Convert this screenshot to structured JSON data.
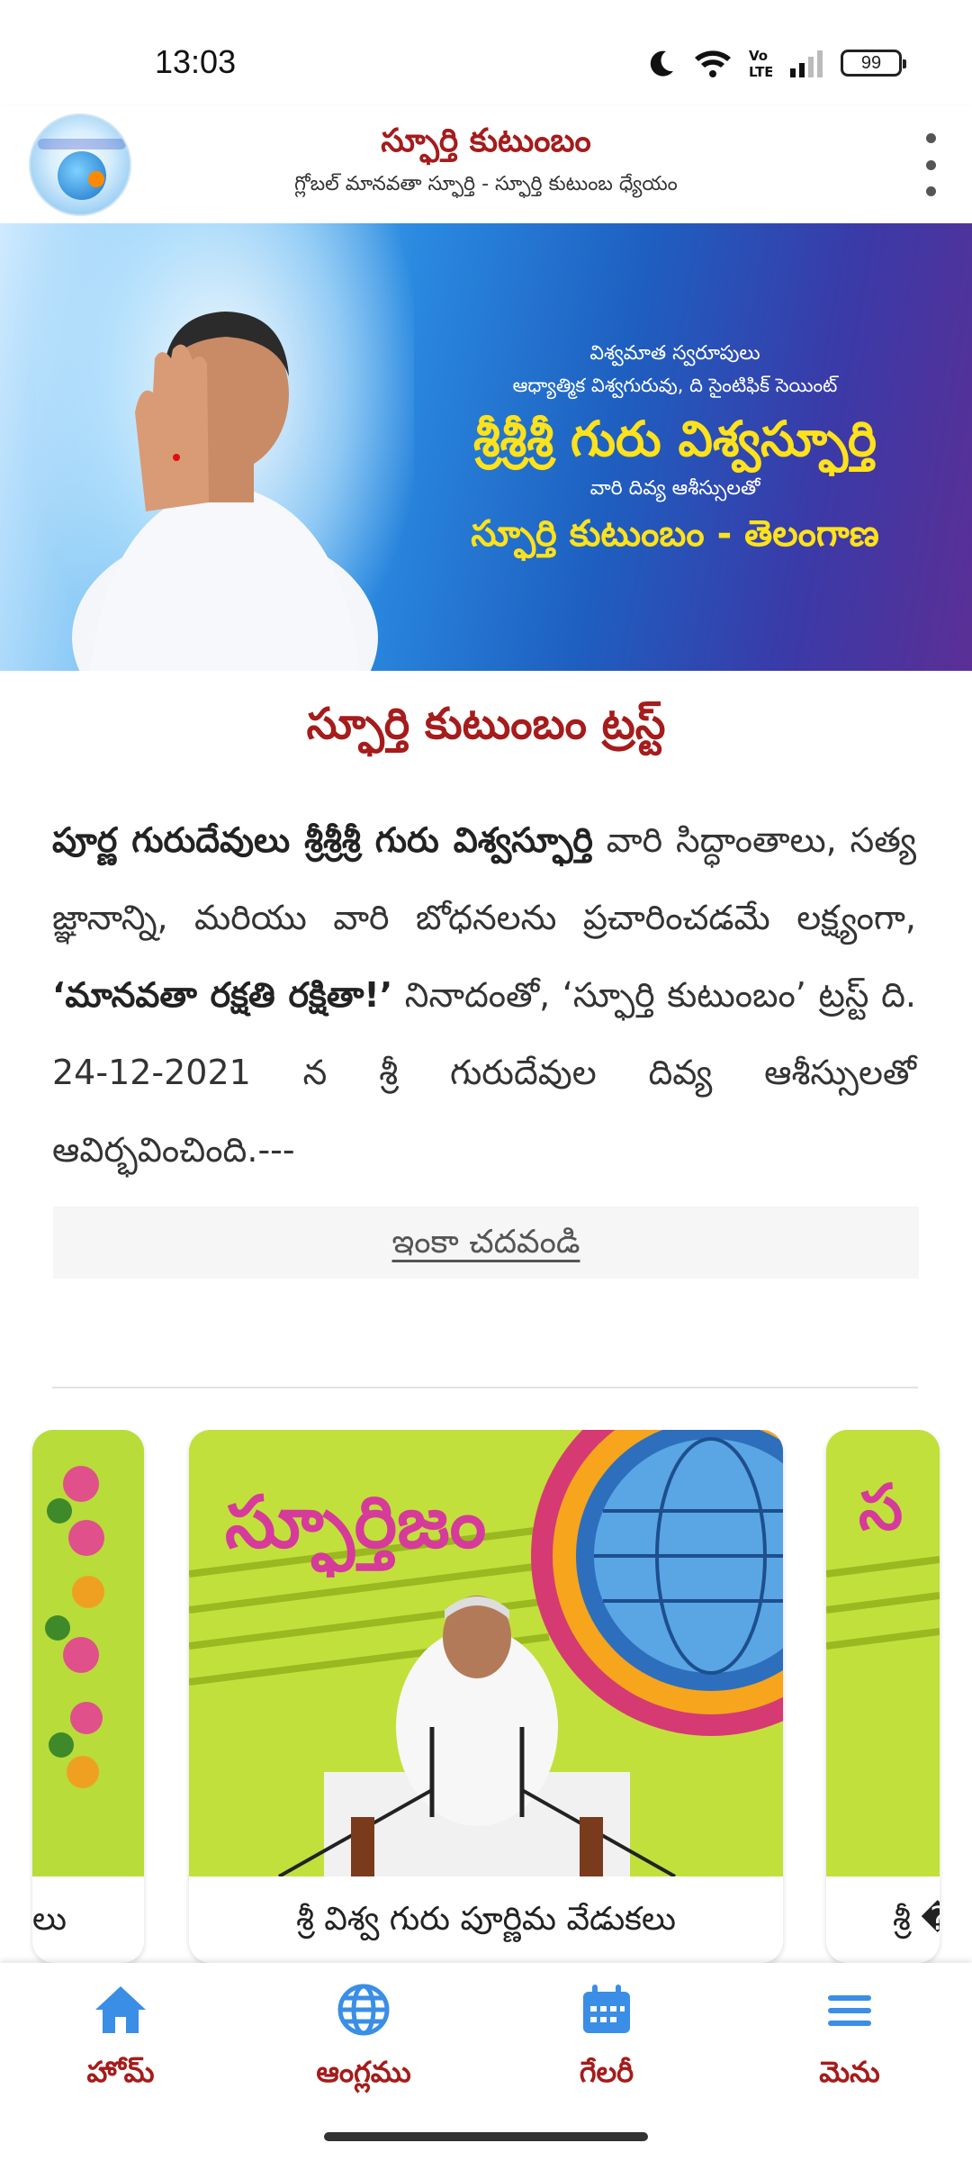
{
  "status_bar": {
    "time": "13:03",
    "battery": "99"
  },
  "header": {
    "title": "స్ఫూర్తి కుటుంబం",
    "subtitle": "గ్లోబల్ మానవతా స్ఫూర్తి - స్ఫూర్తి కుటుంబ ధ్యేయం",
    "logo_icon": "globe-logo-icon",
    "menu_icon": "kebab-menu-icon"
  },
  "banner": {
    "line1": "విశ్వమాత స్వరూపులు",
    "line2": "ఆధ్యాత్మిక విశ్వగురువు, ది సైంటిఫిక్ సెయింట్",
    "line3": "శ్రీశ్రీశ్రీ గురు విశ్వస్ఫూర్తి",
    "line4": "వారి దివ్య ఆశీస్సులతో",
    "line5": "స్ఫూర్తి కుటుంబం - తెలంగాణ"
  },
  "trust": {
    "title": "స్ఫూర్తి కుటుంబం ట్రస్ట్",
    "body_strong1": "పూర్ణ గురుదేవులు శ్రీశ్రీశ్రీ గురు విశ్వస్ఫూర్తి",
    "body_part1": " వారి సిద్ధాంతాలు, సత్య జ్ఞానాన్ని, మరియు వారి బోధనలను ప్రచారించడమే లక్ష్యంగా, ",
    "body_strong2": "‘మానవతా రక్షతి రక్షితా!’",
    "body_part2": " నినాదంతో, ‘స్ఫూర్తి కుటుంబం’ ట్రస్ట్ ది. 24-12-2021 న శ్రీ గురుదేవుల దివ్య ఆశీస్సులతో ఆవిర్భవించింది.---",
    "read_more": "ఇంకా చదవండి"
  },
  "carousel": {
    "left_caption": "లు",
    "main_caption": "శ్రీ విశ్వ గురు పూర్ణిమ వేడుకలు",
    "right_caption": "శ్రీ �ః",
    "main_image_text": "స్ఫూర్తిజం"
  },
  "bottom_nav": [
    {
      "label": "హోమ్",
      "icon": "home-icon",
      "color": "#3a8ee6"
    },
    {
      "label": "ఆంగ్లము",
      "icon": "globe-icon",
      "color": "#3a8ee6"
    },
    {
      "label": "గేలరీ",
      "icon": "calendar-icon",
      "color": "#3a8ee6"
    },
    {
      "label": "మెను",
      "icon": "menu-icon",
      "color": "#3a8ee6"
    }
  ],
  "colors": {
    "brand_red": "#a61b1b",
    "banner_gold": "#ffe21a",
    "nav_icon_blue": "#3a8ee6"
  }
}
